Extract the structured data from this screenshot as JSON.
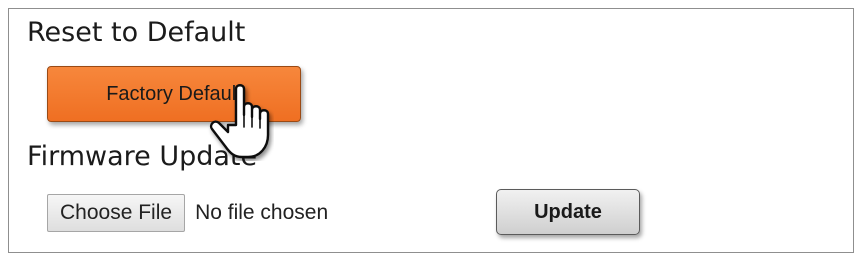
{
  "reset_section": {
    "title": "Reset to Default",
    "factory_default_label": "Factory Default"
  },
  "firmware_section": {
    "title": "Firmware Update",
    "choose_file_label": "Choose File",
    "file_status": "No file chosen",
    "update_label": "Update"
  },
  "colors": {
    "factory_button": "#f07a2c",
    "border": "#8f8f8f"
  },
  "cursor": {
    "icon": "hand-pointer-icon"
  }
}
